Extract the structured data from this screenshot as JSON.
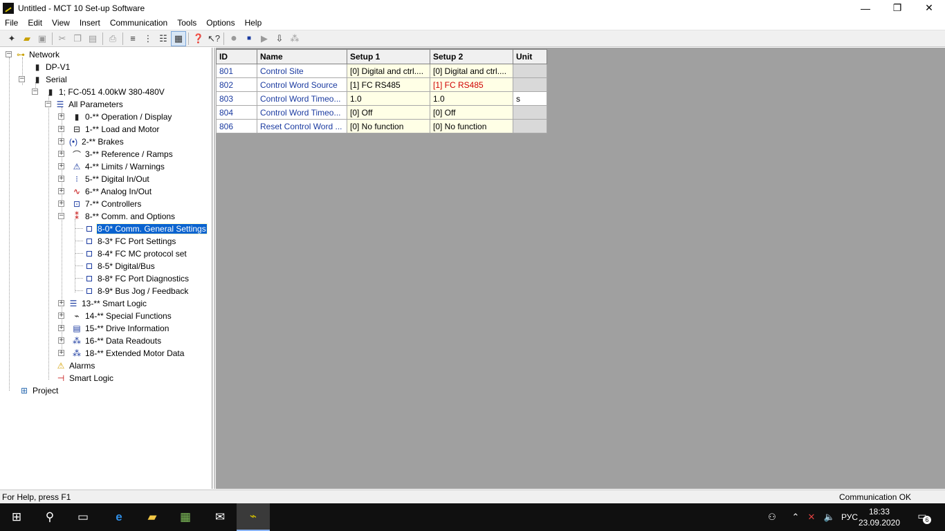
{
  "window": {
    "title": "Untitled - MCT 10 Set-up Software",
    "minimize": "—",
    "maximize": "❐",
    "close": "✕"
  },
  "menu": [
    "File",
    "Edit",
    "View",
    "Insert",
    "Communication",
    "Tools",
    "Options",
    "Help"
  ],
  "toolbar": {
    "icons": [
      "new-icon",
      "open-icon",
      "save-icon",
      "cut-icon",
      "copy-icon",
      "paste-icon",
      "print-icon",
      "list-icon",
      "tree-icon",
      "details-icon",
      "grid-icon",
      "help-icon",
      "context-help-icon",
      "connect-icon",
      "stop-icon",
      "play-icon",
      "read-icon",
      "write-icon"
    ]
  },
  "tree": {
    "network": "Network",
    "dp_v1": "DP-V1",
    "serial": "Serial",
    "drive": "1; FC-051 4.00kW 380-480V",
    "all_parameters": "All Parameters",
    "groups": [
      "0-** Operation / Display",
      "1-** Load and Motor",
      "2-** Brakes",
      "3-** Reference / Ramps",
      "4-** Limits / Warnings",
      "5-** Digital In/Out",
      "6-** Analog In/Out",
      "7-** Controllers",
      "8-** Comm. and Options"
    ],
    "subgroups": [
      "8-0* Comm. General Settings",
      "8-3* FC Port Settings",
      "8-4* FC MC protocol set",
      "8-5* Digital/Bus",
      "8-8* FC Port Diagnostics",
      "8-9* Bus Jog / Feedback"
    ],
    "more_groups": [
      "13-** Smart Logic",
      "14-** Special Functions",
      "15-** Drive Information",
      "16-** Data Readouts",
      "18-** Extended Motor Data"
    ],
    "alarms": "Alarms",
    "smart_logic": "Smart Logic",
    "project": "Project"
  },
  "table": {
    "headers": [
      "ID",
      "Name",
      "Setup 1",
      "Setup 2",
      "Unit"
    ],
    "rows": [
      {
        "id": "801",
        "name": "Control Site",
        "s1": "[0] Digital and ctrl....",
        "s2": "[0] Digital and ctrl....",
        "unit": ""
      },
      {
        "id": "802",
        "name": "Control Word Source",
        "s1": "[1] FC RS485",
        "s2": "[1] FC RS485",
        "unit": ""
      },
      {
        "id": "803",
        "name": "Control Word Timeo...",
        "s1": "1.0",
        "s2": "1.0",
        "unit": "s"
      },
      {
        "id": "804",
        "name": "Control Word Timeo...",
        "s1": "[0] Off",
        "s2": "[0] Off",
        "unit": ""
      },
      {
        "id": "806",
        "name": "Reset Control Word ...",
        "s1": "[0] No function",
        "s2": "[0] No function",
        "unit": ""
      }
    ]
  },
  "status": {
    "left": "For Help, press F1",
    "right": "Communication OK"
  },
  "taskbar": {
    "language": "РУС",
    "time": "18:33",
    "date": "23.09.2020",
    "notifications": "6"
  },
  "colors": {
    "selection": "#0a63cf",
    "link_text": "#1a3aa0",
    "changed_value": "#d00000",
    "grid_bg": "#a0a0a0",
    "cell_bg": "#ffffe6"
  }
}
